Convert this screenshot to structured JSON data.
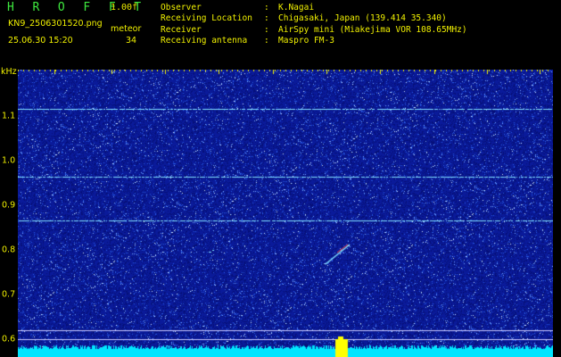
{
  "header": {
    "app_title": "H R O F F T",
    "version": "1.00f",
    "filename": "KN9_2506301520.png",
    "mode_label": "meteor",
    "datetime": "25.06.30 15:20",
    "count": "34",
    "info": [
      {
        "key": "Observer",
        "value": "K.Nagai"
      },
      {
        "key": "Receiving Location",
        "value": "Chigasaki, Japan (139.414 35.340)"
      },
      {
        "key": "Receiver",
        "value": "AirSpy mini (Miakejima VOR 108.65MHz)"
      },
      {
        "key": "Receiving antenna",
        "value": "Maspro FM-3"
      }
    ]
  },
  "plot": {
    "y_unit": "kHz",
    "x_ticks": [
      "1521",
      "1522",
      "1523",
      "1524",
      "1525",
      "1526",
      "1527",
      "1528",
      "1529",
      "1530"
    ],
    "y_ticks": [
      "1.1",
      "1.0",
      "0.9",
      "0.8",
      "0.7",
      "0.6"
    ]
  },
  "colors": {
    "background": "#000000",
    "label": "#f0f000",
    "title": "#3ee83e",
    "waterfall_base": "#0a1a9a",
    "trace": "#80e0ff",
    "meteor": "#ff4040",
    "level_bar": "#00e5ff",
    "level_peak": "#ffff00"
  }
}
